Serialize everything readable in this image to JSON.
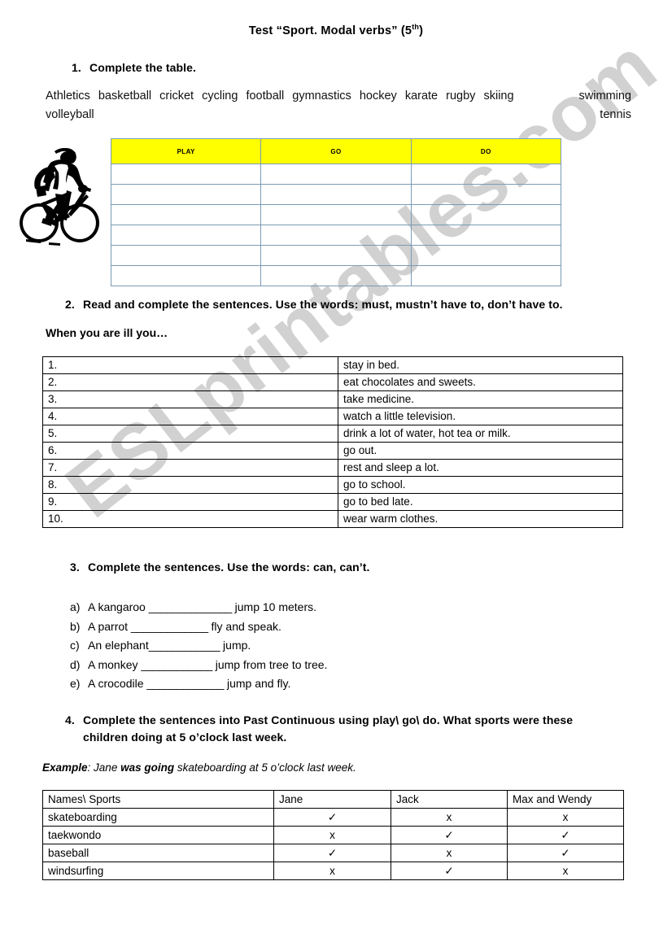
{
  "title": {
    "main": "Test “Sport. Modal verbs” (5",
    "sup": "th",
    "close": ")"
  },
  "watermark": "ESLprintables.com",
  "exercise1": {
    "number": "1.",
    "heading": "Complete the table.",
    "words_row1_left": [
      "Athletics",
      "basketball",
      "cricket",
      "cycling",
      "football",
      "gymnastics",
      "hockey",
      "karate",
      "rugby",
      "skiing"
    ],
    "words_row1_right": "swimming",
    "words_row2_left": "volleyball",
    "words_row2_right": "tennis",
    "table": {
      "headers": [
        "PLAY",
        "GO",
        "DO"
      ],
      "empty_row_count": 6
    }
  },
  "exercise2": {
    "number": "2.",
    "heading": "Read and complete the sentences. Use the words: must, mustn’t have to, don’t have to.",
    "lead_in": "When you are ill you…",
    "rows": [
      {
        "num": "1.",
        "text": "stay in bed."
      },
      {
        "num": "2.",
        "text": "eat chocolates and sweets."
      },
      {
        "num": "3.",
        "text": "take medicine."
      },
      {
        "num": "4.",
        "text": "watch a little television."
      },
      {
        "num": "5.",
        "text": "drink a lot of water, hot tea or milk."
      },
      {
        "num": "6.",
        "text": "go out."
      },
      {
        "num": "7.",
        "text": "rest and sleep a lot."
      },
      {
        "num": "8.",
        "text": "go to school."
      },
      {
        "num": "9.",
        "text": "go to bed late."
      },
      {
        "num": "10.",
        "text": "wear warm clothes."
      }
    ]
  },
  "exercise3": {
    "number": "3.",
    "heading": "Complete the sentences. Use the words: can, can’t.",
    "items": [
      {
        "label": "a)",
        "before": "A kangaroo ",
        "blank": "______________",
        "after": " jump 10 meters."
      },
      {
        "label": "b)",
        "before": "A parrot ",
        "blank": "_____________",
        "after": " fly and speak."
      },
      {
        "label": "c)",
        "before": "An elephant",
        "blank": "____________",
        "after": " jump."
      },
      {
        "label": "d)",
        "before": "A monkey ",
        "blank": "____________",
        "after": " jump from tree to tree."
      },
      {
        "label": "e)",
        "before": "A crocodile ",
        "blank": "_____________",
        "after": " jump and fly."
      }
    ]
  },
  "exercise4": {
    "number": "4.",
    "heading_line1": "Complete the sentences into Past Continuous using play\\ go\\ do. What sports were these",
    "heading_line2": "children doing at 5 o’clock last week.",
    "example_label": "Example",
    "example_sep": ": ",
    "example_part1": "Jane ",
    "example_bold": "was going",
    "example_part2": " skateboarding at 5 o’clock last week.",
    "table": {
      "headers": [
        "Names\\ Sports",
        "Jane",
        "Jack",
        "Max and Wendy"
      ],
      "rows": [
        {
          "sport": "skateboarding",
          "marks": [
            "✓",
            "x",
            "x"
          ]
        },
        {
          "sport": "taekwondo",
          "marks": [
            "x",
            "✓",
            "✓"
          ]
        },
        {
          "sport": "baseball",
          "marks": [
            "✓",
            "x",
            "✓"
          ]
        },
        {
          "sport": "windsurfing",
          "marks": [
            "x",
            "✓",
            "x"
          ]
        }
      ]
    }
  },
  "colors": {
    "header_fill": "#ffff00",
    "table1_border": "#7a9bb5",
    "table_border": "#000000",
    "watermark": "#c9c9c9"
  }
}
